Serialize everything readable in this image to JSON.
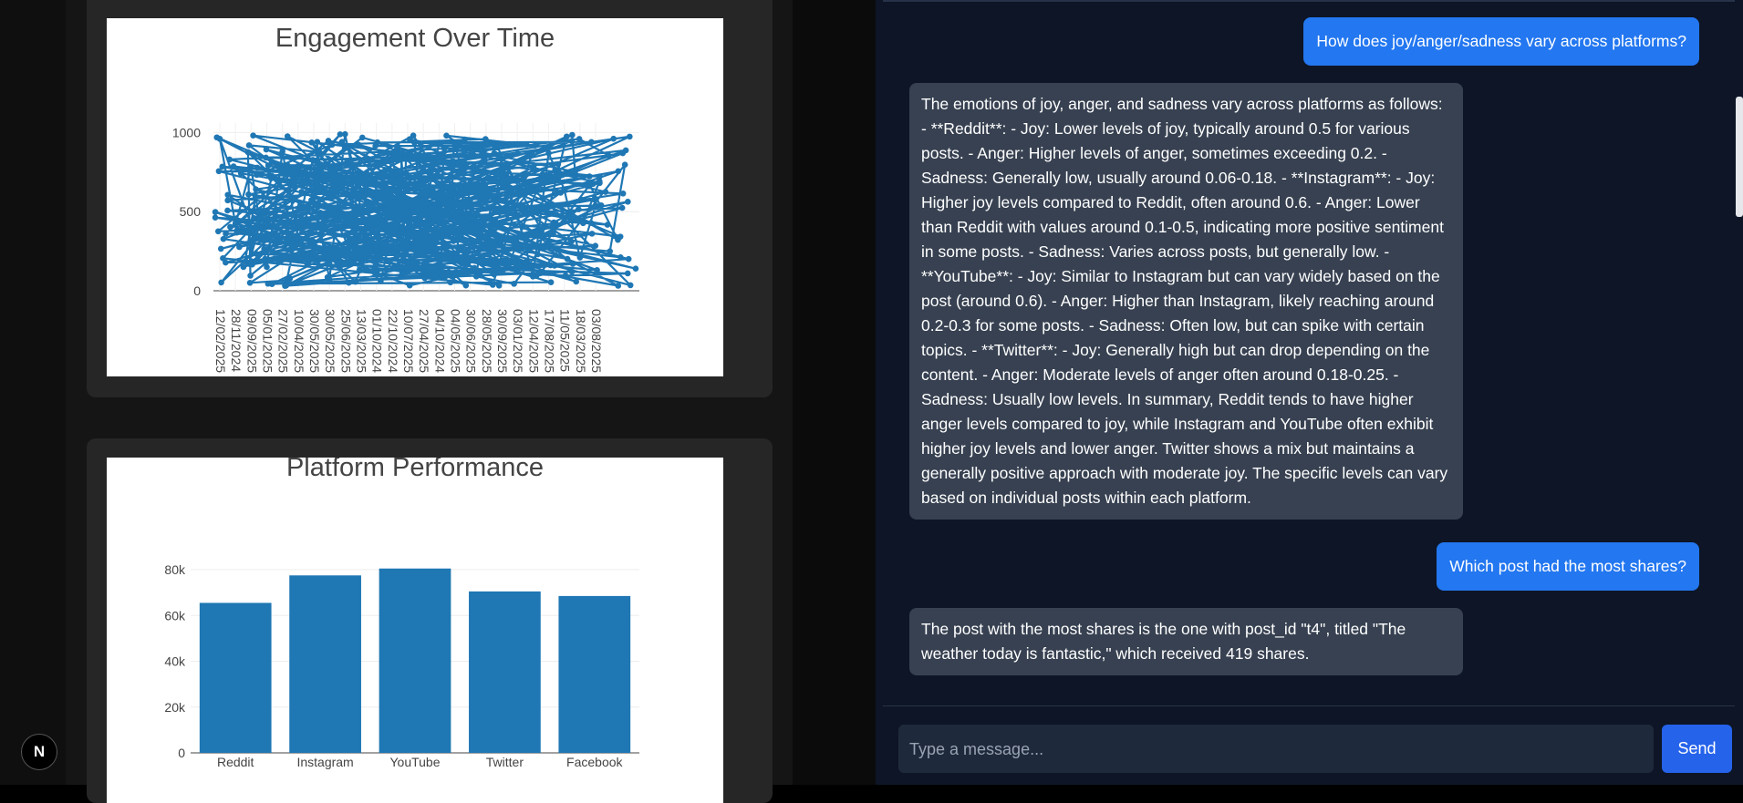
{
  "charts": {
    "engagement": {
      "title": "Engagement Over Time",
      "yticks": [
        "0",
        "500",
        "1000"
      ],
      "xticks": [
        "12/02/2025",
        "28/11/2024",
        "09/09/2025",
        "05/01/2025",
        "27/02/2025",
        "10/04/2025",
        "30/05/2025",
        "30/05/2025",
        "25/06/2025",
        "13/03/2025",
        "01/10/2024",
        "22/10/2024",
        "10/07/2025",
        "27/04/2025",
        "04/10/2024",
        "04/05/2025",
        "30/06/2025",
        "28/05/2025",
        "30/09/2025",
        "03/01/2025",
        "12/04/2025",
        "17/08/2025",
        "11/05/2025",
        "18/03/2025",
        "03/08/2025"
      ],
      "color": "#1f77b4"
    },
    "platform": {
      "title": "Platform Performance",
      "color": "#1f77b4"
    }
  },
  "chart_data": [
    {
      "type": "line",
      "title": "Engagement Over Time",
      "xlabel": "",
      "ylabel": "",
      "ylim": [
        0,
        1000
      ],
      "x_tick_labels": [
        "12/02/2025",
        "28/11/2024",
        "09/09/2025",
        "05/01/2025",
        "27/02/2025",
        "10/04/2025",
        "30/05/2025",
        "30/05/2025",
        "25/06/2025",
        "13/03/2025",
        "01/10/2024",
        "22/10/2024",
        "10/07/2025",
        "27/04/2025",
        "04/10/2024",
        "04/05/2025",
        "30/06/2025",
        "28/05/2025",
        "30/09/2025",
        "03/01/2025",
        "12/04/2025",
        "17/08/2025",
        "11/05/2025",
        "18/03/2025",
        "03/08/2025"
      ],
      "series": [
        {
          "values": [
            960,
            420,
            780,
            150,
            880,
            330,
            610,
            70,
            990,
            520,
            260,
            840,
            400,
            700,
            120,
            930,
            560,
            300,
            760,
            480,
            90,
            870,
            640,
            210,
            540
          ]
        }
      ]
    },
    {
      "type": "bar",
      "title": "Platform Performance",
      "categories": [
        "Reddit",
        "Instagram",
        "YouTube",
        "Twitter",
        "Facebook"
      ],
      "values": [
        65500,
        77500,
        80500,
        70500,
        68500
      ],
      "ylim": [
        0,
        88000
      ],
      "yticks": [
        "0",
        "20k",
        "40k",
        "60k",
        "80k"
      ]
    }
  ],
  "chat": {
    "messages": [
      {
        "role": "user",
        "text": "How does joy/anger/sadness vary across platforms?"
      },
      {
        "role": "bot",
        "text": "The emotions of joy, anger, and sadness vary across platforms as follows: - **Reddit**: - Joy: Lower levels of joy, typically around 0.5 for various posts. - Anger: Higher levels of anger, sometimes exceeding 0.2. - Sadness: Generally low, usually around 0.06-0.18. - **Instagram**: - Joy: Higher joy levels compared to Reddit, often around 0.6. - Anger: Lower than Reddit with values around 0.1-0.5, indicating more positive sentiment in some posts. - Sadness: Varies across posts, but generally low. - **YouTube**: - Joy: Similar to Instagram but can vary widely based on the post (around 0.6). - Anger: Higher than Instagram, likely reaching around 0.2-0.3 for some posts. - Sadness: Often low, but can spike with certain topics. - **Twitter**: - Joy: Generally high but can drop depending on the content. - Anger: Moderate levels of anger often around 0.18-0.25. - Sadness: Usually low levels. In summary, Reddit tends to have higher anger levels compared to joy, while Instagram and YouTube often exhibit higher joy levels and lower anger. Twitter shows a mix but maintains a generally positive approach with moderate joy. The specific levels can vary based on individual posts within each platform."
      },
      {
        "role": "user",
        "text": "Which post had the most shares?"
      },
      {
        "role": "bot",
        "text": "The post with the most shares is the one with post_id \"t4\", titled \"The weather today is fantastic,\" which received 419 shares."
      }
    ],
    "input_placeholder": "Type a message...",
    "send_label": "Send"
  },
  "badge": {
    "letter": "N",
    "icon": "nextjs-logo-icon"
  }
}
